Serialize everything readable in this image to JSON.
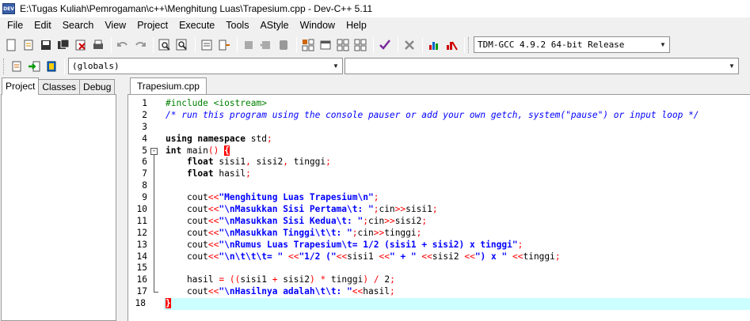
{
  "window": {
    "title": "E:\\Tugas Kuliah\\Pemrogaman\\c++\\Menghitung Luas\\Trapesium.cpp - Dev-C++ 5.11",
    "app_icon_text": "DEV"
  },
  "menu": [
    "File",
    "Edit",
    "Search",
    "View",
    "Project",
    "Execute",
    "Tools",
    "AStyle",
    "Window",
    "Help"
  ],
  "toolbar": {
    "compiler_select": "TDM-GCC 4.9.2 64-bit Release",
    "scope_select": "(globals)",
    "member_select": ""
  },
  "left_panel": {
    "tabs": [
      "Project",
      "Classes",
      "Debug"
    ],
    "active_tab": "Project"
  },
  "editor": {
    "tab_label": "Trapesium.cpp",
    "line_numbers": [
      "1",
      "2",
      "3",
      "4",
      "5",
      "6",
      "7",
      "8",
      "9",
      "10",
      "11",
      "12",
      "13",
      "14",
      "15",
      "16",
      "17",
      "18"
    ]
  }
}
